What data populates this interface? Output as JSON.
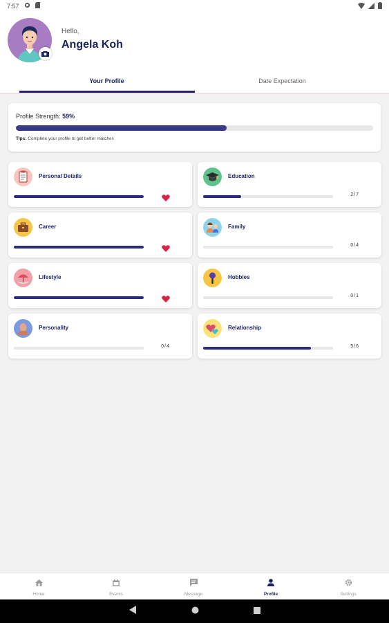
{
  "status_bar": {
    "time": "7:57"
  },
  "header": {
    "greeting": "Hello,",
    "user_name": "Angela Koh"
  },
  "tabs": [
    {
      "label": "Your Profile",
      "active": true
    },
    {
      "label": "Date Expectation",
      "active": false
    }
  ],
  "profile_strength": {
    "title": "Profile Strength:",
    "value_text": "59%",
    "value": 0.59,
    "tips_label": "Tips:",
    "tips_text": "Complete your profile to get better matches"
  },
  "categories": [
    {
      "label": "Personal Details",
      "icon": "clipboard-icon",
      "progress": 1.0,
      "complete": true,
      "count": ""
    },
    {
      "label": "Education",
      "icon": "graduation-cap-icon",
      "progress": 0.29,
      "complete": false,
      "count": "2/7"
    },
    {
      "label": "Career",
      "icon": "briefcase-icon",
      "progress": 1.0,
      "complete": true,
      "count": ""
    },
    {
      "label": "Family",
      "icon": "family-icon",
      "progress": 0,
      "complete": false,
      "count": "0/4"
    },
    {
      "label": "Lifestyle",
      "icon": "lifestyle-icon",
      "progress": 1.0,
      "complete": true,
      "count": ""
    },
    {
      "label": "Hobbies",
      "icon": "microphone-icon",
      "progress": 0,
      "complete": false,
      "count": "0/1"
    },
    {
      "label": "Personality",
      "icon": "personality-icon",
      "progress": 0,
      "complete": false,
      "count": "0/4"
    },
    {
      "label": "Relationship",
      "icon": "hearts-icon",
      "progress": 0.83,
      "complete": false,
      "count": "5/6"
    }
  ],
  "bottom_nav": [
    {
      "label": "Home",
      "icon": "home-icon",
      "active": false
    },
    {
      "label": "Events",
      "icon": "calendar-icon",
      "active": false
    },
    {
      "label": "Message",
      "icon": "message-icon",
      "active": false
    },
    {
      "label": "Profile",
      "icon": "person-icon",
      "active": true
    },
    {
      "label": "Settings",
      "icon": "gear-icon",
      "active": false
    }
  ],
  "colors": {
    "primary": "#1c2461",
    "progress_fill": "#2c2c7e",
    "heart": "#d6244a",
    "avatar_bg": "#a87cc3",
    "background": "#f2f2f2"
  }
}
